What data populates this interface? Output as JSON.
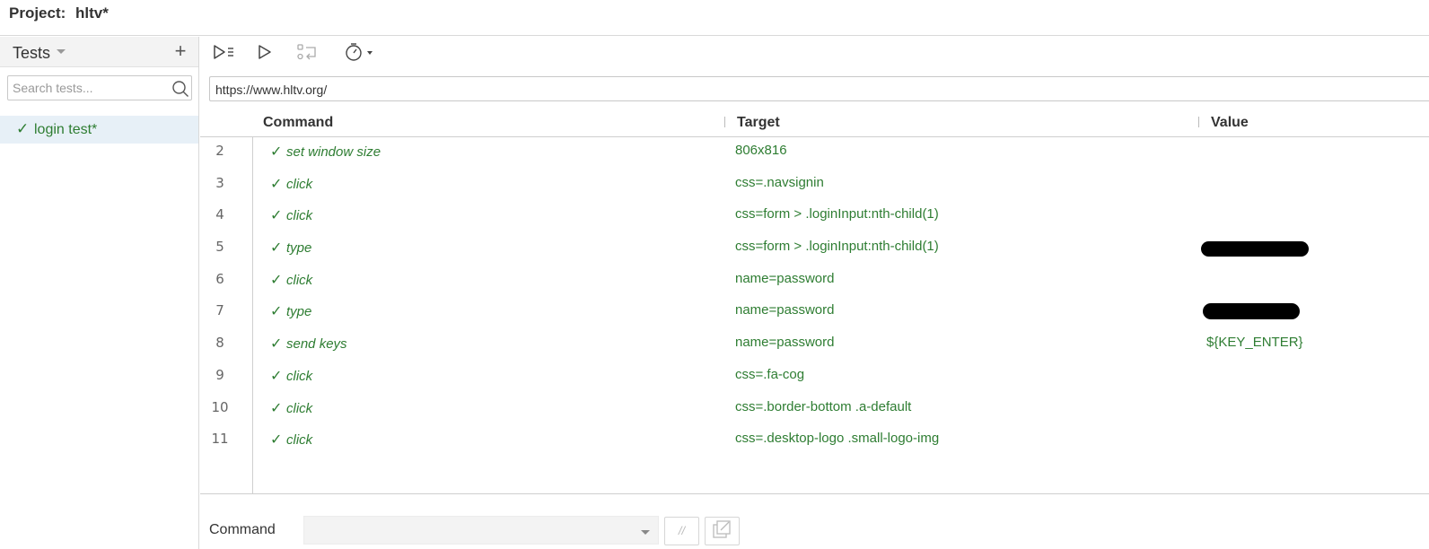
{
  "header": {
    "project_label": "Project:",
    "project_name": "hltv*"
  },
  "sidebar": {
    "title": "Tests",
    "add_label": "+",
    "search_placeholder": "Search tests...",
    "tests": [
      {
        "name": "login test*",
        "status": "passed",
        "check": "✓",
        "selected": true
      }
    ]
  },
  "toolbar": {
    "buttons": [
      "run-all-icon",
      "run-icon",
      "step-over-icon",
      "timer-icon"
    ]
  },
  "url": {
    "value": "https://www.hltv.org/"
  },
  "table": {
    "headers": {
      "command": "Command",
      "target": "Target",
      "value": "Value"
    },
    "check": "✓",
    "rows": [
      {
        "num": "2",
        "command": "set window size",
        "target": "806x816",
        "value": ""
      },
      {
        "num": "3",
        "command": "click",
        "target": "css=.navsignin",
        "value": ""
      },
      {
        "num": "4",
        "command": "click",
        "target": "css=form > .loginInput:nth-child(1)",
        "value": ""
      },
      {
        "num": "5",
        "command": "type",
        "target": "css=form > .loginInput:nth-child(1)",
        "value": "",
        "value_redacted": true
      },
      {
        "num": "6",
        "command": "click",
        "target": "name=password",
        "value": ""
      },
      {
        "num": "7",
        "command": "type",
        "target": "name=password",
        "value": "",
        "value_redacted": true
      },
      {
        "num": "8",
        "command": "send keys",
        "target": "name=password",
        "value": "${KEY_ENTER}"
      },
      {
        "num": "9",
        "command": "click",
        "target": "css=.fa-cog",
        "value": ""
      },
      {
        "num": "10",
        "command": "click",
        "target": "css=.border-bottom .a-default",
        "value": ""
      },
      {
        "num": "11",
        "command": "click",
        "target": "css=.desktop-logo .small-logo-img",
        "value": ""
      }
    ]
  },
  "editor": {
    "command_label": "Command",
    "command_value": "",
    "comment_label": "//"
  },
  "colors": {
    "pass_green": "#2e7d32",
    "selected_bg": "#e7f0f7",
    "header_bg": "#f3f3f3"
  }
}
